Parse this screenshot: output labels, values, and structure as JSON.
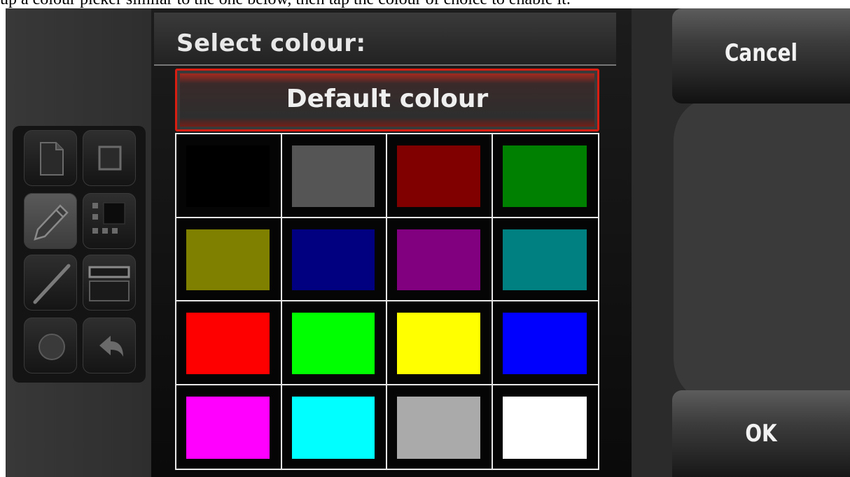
{
  "caption": "up a colour picker similar to the one below, then tap the colour of choice to enable it.",
  "dialog": {
    "title": "Select colour:",
    "default_label": "Default colour",
    "accent_color": "#d81e12"
  },
  "swatches": [
    {
      "name": "black",
      "color": "#000000"
    },
    {
      "name": "dark-gray",
      "color": "#555555"
    },
    {
      "name": "maroon",
      "color": "#800000"
    },
    {
      "name": "green",
      "color": "#008000"
    },
    {
      "name": "olive",
      "color": "#808000"
    },
    {
      "name": "navy",
      "color": "#000080"
    },
    {
      "name": "purple",
      "color": "#800080"
    },
    {
      "name": "teal",
      "color": "#008080"
    },
    {
      "name": "red",
      "color": "#ff0000"
    },
    {
      "name": "lime",
      "color": "#00ff00"
    },
    {
      "name": "yellow",
      "color": "#ffff00"
    },
    {
      "name": "blue",
      "color": "#0000ff"
    },
    {
      "name": "magenta",
      "color": "#ff00ff"
    },
    {
      "name": "cyan",
      "color": "#00ffff"
    },
    {
      "name": "silver",
      "color": "#aaaaaa"
    },
    {
      "name": "white",
      "color": "#ffffff"
    }
  ],
  "buttons": {
    "cancel": "Cancel",
    "ok": "OK"
  },
  "toolbar": {
    "tools": [
      "new-page-icon",
      "square-icon",
      "pencil-icon",
      "grid-icon",
      "line-icon",
      "rectangle-icon",
      "circle-icon",
      "undo-icon"
    ],
    "active_tool": "pencil-icon"
  }
}
